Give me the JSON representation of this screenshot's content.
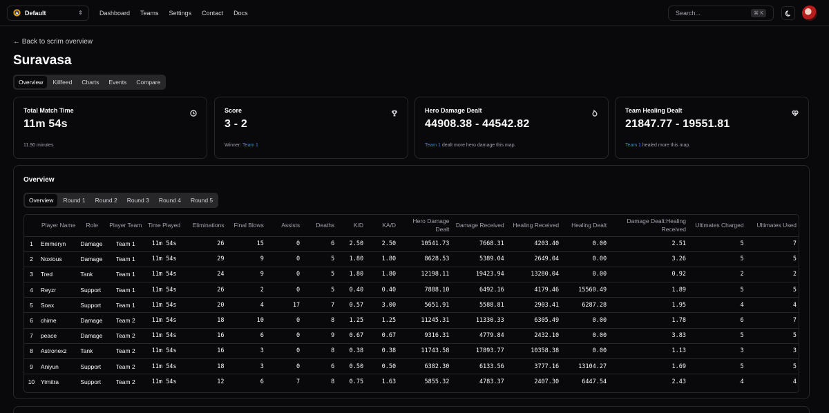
{
  "topbar": {
    "team_select": "Default",
    "nav": [
      "Dashboard",
      "Teams",
      "Settings",
      "Contact",
      "Docs"
    ],
    "search_placeholder": "Search...",
    "search_kbd": "⌘ K"
  },
  "back_link": "← Back to scrim overview",
  "page_title": "Suravasa",
  "main_tabs": [
    "Overview",
    "Killfeed",
    "Charts",
    "Events",
    "Compare"
  ],
  "cards": [
    {
      "label": "Total Match Time",
      "value": "11m 54s",
      "sub_pre": "11.90 minutes",
      "sub_link": "",
      "sub_post": "",
      "icon": "clock-icon"
    },
    {
      "label": "Score",
      "value": "3 - 2",
      "sub_pre": "Winner: ",
      "sub_link": "Team 1",
      "sub_post": "",
      "icon": "trophy-icon"
    },
    {
      "label": "Hero Damage Dealt",
      "value": "44908.38 - 44542.82",
      "sub_pre": "",
      "sub_link": "Team 1",
      "sub_post": " dealt more hero damage this map.",
      "icon": "flame-icon"
    },
    {
      "label": "Team Healing Dealt",
      "value": "21847.77 - 19551.81",
      "sub_pre": "",
      "sub_link": "Team 1",
      "sub_post": " healed more this map.",
      "icon": "heart-pulse-icon"
    }
  ],
  "overview": {
    "title": "Overview",
    "tabs": [
      "Overview",
      "Round 1",
      "Round 2",
      "Round 3",
      "Round 4",
      "Round 5"
    ],
    "columns": [
      "",
      "Player Name",
      "Role",
      "Player Team",
      "Time Played",
      "Eliminations",
      "Final Blows",
      "Assists",
      "Deaths",
      "K/D",
      "KA/D",
      "Hero Damage Dealt",
      "Damage Received",
      "Healing Received",
      "Healing Dealt",
      "Damage Dealt:Healing Received",
      "Ultimates Charged",
      "Ultimates Used"
    ],
    "rows": [
      [
        "1",
        "Emmeryn",
        "Damage",
        "Team 1",
        "11m 54s",
        "26",
        "15",
        "0",
        "6",
        "2.50",
        "2.50",
        "10541.73",
        "7668.31",
        "4203.40",
        "0.00",
        "2.51",
        "5",
        "7"
      ],
      [
        "2",
        "Noxious",
        "Damage",
        "Team 1",
        "11m 54s",
        "29",
        "9",
        "0",
        "5",
        "1.80",
        "1.80",
        "8628.53",
        "5389.04",
        "2649.04",
        "0.00",
        "3.26",
        "5",
        "5"
      ],
      [
        "3",
        "Tred",
        "Tank",
        "Team 1",
        "11m 54s",
        "24",
        "9",
        "0",
        "5",
        "1.80",
        "1.80",
        "12198.11",
        "19423.94",
        "13280.04",
        "0.00",
        "0.92",
        "2",
        "2"
      ],
      [
        "4",
        "Reyzr",
        "Support",
        "Team 1",
        "11m 54s",
        "26",
        "2",
        "0",
        "5",
        "0.40",
        "0.40",
        "7888.10",
        "6492.16",
        "4179.46",
        "15560.49",
        "1.89",
        "5",
        "5"
      ],
      [
        "5",
        "Soax",
        "Support",
        "Team 1",
        "11m 54s",
        "20",
        "4",
        "17",
        "7",
        "0.57",
        "3.00",
        "5651.91",
        "5588.81",
        "2903.41",
        "6287.28",
        "1.95",
        "4",
        "4"
      ],
      [
        "6",
        "chime",
        "Damage",
        "Team 2",
        "11m 54s",
        "18",
        "10",
        "0",
        "8",
        "1.25",
        "1.25",
        "11245.31",
        "11330.33",
        "6305.49",
        "0.00",
        "1.78",
        "6",
        "7"
      ],
      [
        "7",
        "peace",
        "Damage",
        "Team 2",
        "11m 54s",
        "16",
        "6",
        "0",
        "9",
        "0.67",
        "0.67",
        "9316.31",
        "4779.84",
        "2432.10",
        "0.00",
        "3.83",
        "5",
        "5"
      ],
      [
        "8",
        "Astronexz",
        "Tank",
        "Team 2",
        "11m 54s",
        "16",
        "3",
        "0",
        "8",
        "0.38",
        "0.38",
        "11743.58",
        "17893.77",
        "10358.38",
        "0.00",
        "1.13",
        "3",
        "3"
      ],
      [
        "9",
        "Aniyun",
        "Support",
        "Team 2",
        "11m 54s",
        "18",
        "3",
        "0",
        "6",
        "0.50",
        "0.50",
        "6382.30",
        "6133.56",
        "3777.16",
        "13104.27",
        "1.69",
        "5",
        "5"
      ],
      [
        "10",
        "Yimitra",
        "Support",
        "Team 2",
        "11m 54s",
        "12",
        "6",
        "7",
        "8",
        "0.75",
        "1.63",
        "5855.32",
        "4783.37",
        "2407.30",
        "6447.54",
        "2.43",
        "4",
        "4"
      ]
    ]
  }
}
